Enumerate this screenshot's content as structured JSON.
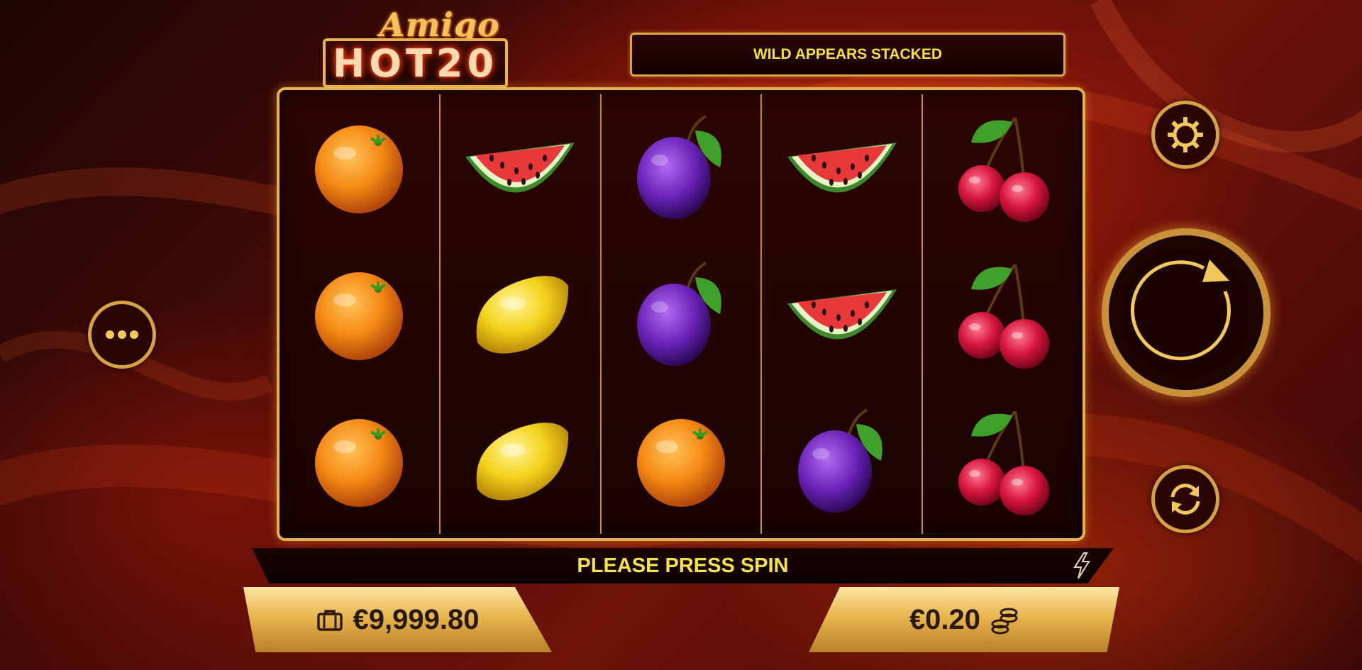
{
  "logo": {
    "script": "Amigo",
    "main": "HOT20"
  },
  "info_banner": {
    "text": "WILD APPEARS STACKED"
  },
  "reels": [
    [
      "orange",
      "orange",
      "orange"
    ],
    [
      "watermelon",
      "lemon",
      "lemon"
    ],
    [
      "plum",
      "plum",
      "orange"
    ],
    [
      "watermelon",
      "watermelon",
      "plum"
    ],
    [
      "cherries",
      "cherries",
      "cherries"
    ]
  ],
  "status": {
    "text": "PLEASE PRESS SPIN"
  },
  "balance": {
    "amount": "€9,999.80",
    "icon": "wallet-icon"
  },
  "bet": {
    "amount": "€0.20",
    "icon": "coins-icon"
  },
  "buttons": {
    "menu_icon": "more-dots-icon",
    "settings_icon": "gear-icon",
    "spin_icon": "spin-arrow-icon",
    "autoplay_icon": "autoplay-icon",
    "turbo_icon": "lightning-icon"
  },
  "colors": {
    "gold": "#e2b150",
    "banner_text": "#f4e23a",
    "background": "#6e120a"
  }
}
